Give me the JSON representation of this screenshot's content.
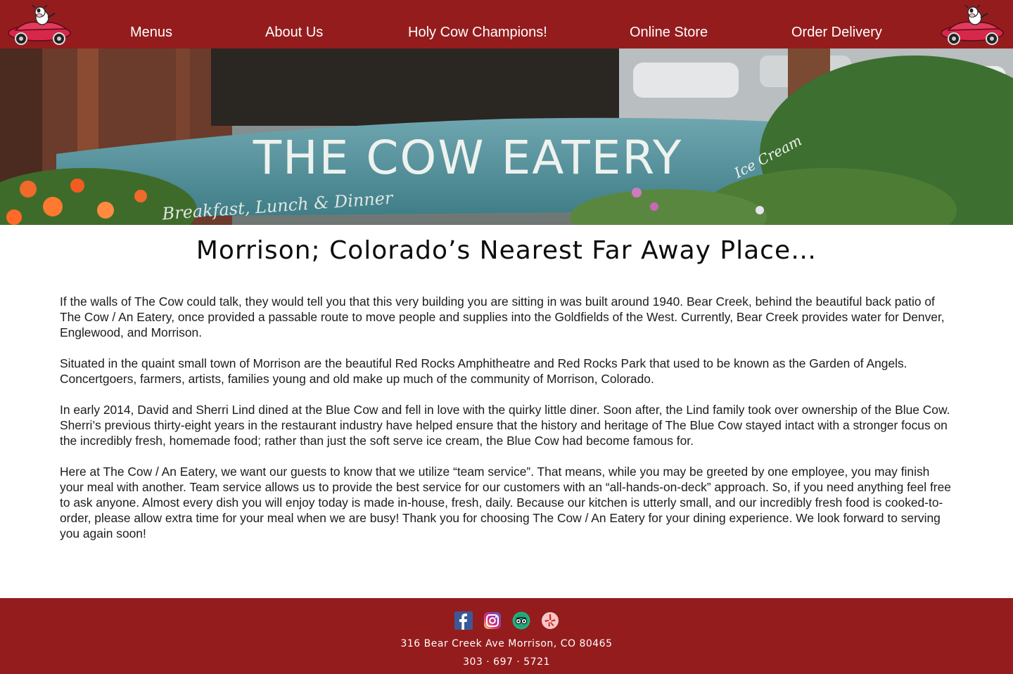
{
  "colors": {
    "brand_red": "#941c1d",
    "text": "#1c1c1c",
    "footer_text": "#ffffff"
  },
  "header": {
    "logo_icon": "cow-driving-red-car-logo",
    "nav": [
      {
        "label": "Menus"
      },
      {
        "label": "About Us"
      },
      {
        "label": "Holy Cow Champions!"
      },
      {
        "label": "Online Store"
      },
      {
        "label": "Order Delivery"
      }
    ]
  },
  "hero": {
    "sign_text": "THE COW EATERY",
    "sign_subtext": "Breakfast, Lunch & Dinner",
    "sign_side_text": "Ice Cream"
  },
  "main": {
    "headline": "Morrison; Colorado’s Nearest Far Away Place…",
    "paragraphs": [
      "If the walls of The Cow could talk, they would tell you that this very building you are sitting in was built around 1940. Bear Creek, behind the beautiful back patio of The Cow / An Eatery, once provided a passable route to move people and supplies into the Goldfields of the West. Currently, Bear Creek provides water for Denver, Englewood, and Morrison.",
      "Situated in the quaint small town of Morrison are the beautiful Red Rocks Amphitheatre and Red Rocks Park that used to be known as the Garden of Angels. Concertgoers, farmers, artists, families young and old make up much of the community of Morrison, Colorado.",
      "In early 2014, David and Sherri Lind dined at the Blue Cow and fell in love with the quirky little diner. Soon after, the Lind family took over ownership of the Blue Cow. Sherri’s previous thirty-eight years in the restaurant industry have helped ensure that the history and heritage of The Blue Cow stayed intact with a stronger focus on the incredibly fresh, homemade food; rather than just the soft serve ice cream, the Blue Cow had become famous for.",
      "Here at The Cow / An Eatery, we want our guests to know that we utilize “team service”. That means, while you may be greeted by one employee, you may finish your meal with another. Team service allows us to provide the best service for our customers with an “all-hands-on-deck” approach. So, if you need anything feel free to ask anyone. Almost every dish you will enjoy today is made in-house, fresh, daily. Because our kitchen is utterly small, and our incredibly fresh food is cooked-to-order, please allow extra time for your meal when we are busy! Thank you for choosing The Cow / An Eatery for your dining experience. We look forward to serving you again soon!"
    ]
  },
  "footer": {
    "social_icons": [
      "facebook-icon",
      "instagram-icon",
      "tripadvisor-icon",
      "yelp-icon"
    ],
    "address": "316 Bear Creek Ave Morrison, CO 80465",
    "phone": "303 · 697 · 5721"
  }
}
